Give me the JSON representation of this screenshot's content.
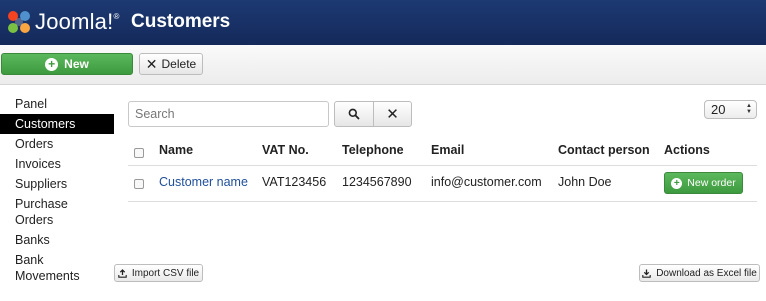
{
  "app": {
    "logo_text": "Joomla!",
    "logo_trademark": "®",
    "page_title": "Customers"
  },
  "toolbar": {
    "new_label": "New",
    "delete_label": "Delete"
  },
  "sidebar": {
    "items": [
      {
        "label": "Panel",
        "active": false
      },
      {
        "label": "Customers",
        "active": true
      },
      {
        "label": "Orders",
        "active": false
      },
      {
        "label": "Invoices",
        "active": false
      },
      {
        "label": "Suppliers",
        "active": false
      },
      {
        "label": "Purchase Orders",
        "active": false
      },
      {
        "label": "Banks",
        "active": false
      },
      {
        "label": "Bank Movements",
        "active": false
      }
    ]
  },
  "search": {
    "placeholder": "Search",
    "value": ""
  },
  "list_limit": {
    "value": "20"
  },
  "table": {
    "columns": [
      "Name",
      "VAT No.",
      "Telephone",
      "Email",
      "Contact person",
      "Actions"
    ],
    "rows": [
      {
        "name": "Customer name",
        "vat": "VAT123456",
        "telephone": "1234567890",
        "email": "info@customer.com",
        "contact": "John Doe",
        "action_label": "New order"
      }
    ]
  },
  "footer": {
    "import_label": "Import CSV file",
    "export_label": "Download as Excel file"
  },
  "colors": {
    "header_bg": "#1d3a73",
    "primary_green": "#4cae4c",
    "link_blue": "#1f4f9a",
    "active_nav_bg": "#000000"
  },
  "icons": {
    "logo": "joomla-logo-icon",
    "new": "plus-circle-icon",
    "delete": "x-icon",
    "search": "search-icon",
    "clear": "x-icon",
    "limit": "updown-arrows-icon",
    "import": "upload-icon",
    "export": "download-icon"
  }
}
